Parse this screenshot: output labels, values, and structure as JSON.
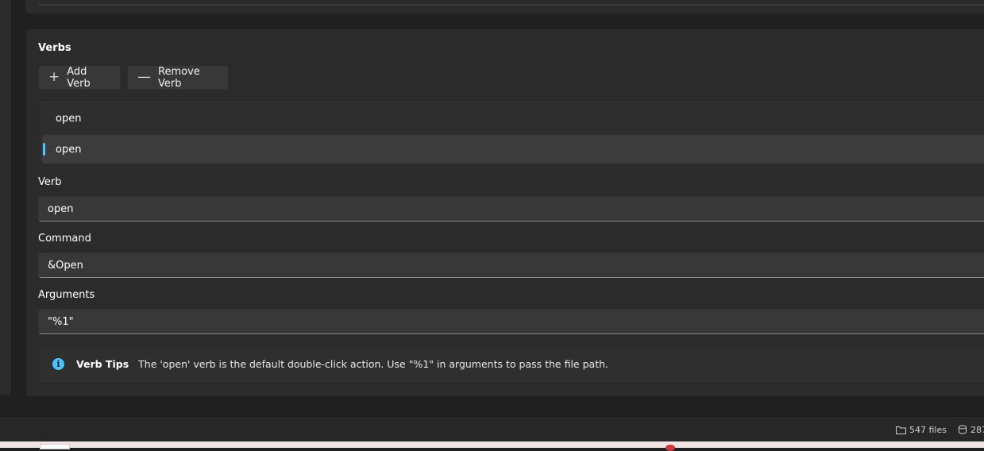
{
  "verbs_section": {
    "title": "Verbs",
    "add_button": {
      "glyph": "+",
      "label": "Add Verb",
      "icon": "plus-icon"
    },
    "remove_button": {
      "glyph": "—",
      "label": "Remove Verb",
      "icon": "minus-icon"
    },
    "list": [
      {
        "label": "open",
        "selected": false
      },
      {
        "label": "open",
        "selected": true
      }
    ]
  },
  "form": {
    "verb": {
      "label": "Verb",
      "value": "open"
    },
    "command": {
      "label": "Command",
      "value": "&Open"
    },
    "arguments": {
      "label": "Arguments",
      "value": "\"%1\""
    }
  },
  "tip": {
    "icon": "info-icon",
    "icon_glyph": "i",
    "title": "Verb Tips",
    "text": "The 'open' verb is the default double-click action. Use \"%1\" in arguments to pass the file path."
  },
  "status_bar": {
    "files": "547 files",
    "other": "287",
    "files_icon": "folder-icon",
    "other_icon": "database-icon"
  },
  "colors": {
    "accent": "#4cc2ff",
    "background": "#202020",
    "card": "#2b2b2b"
  }
}
